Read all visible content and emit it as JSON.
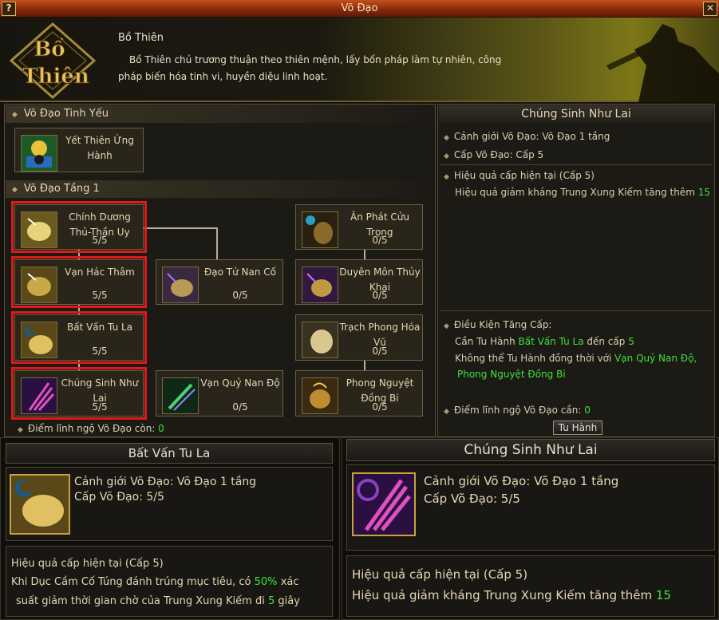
{
  "window": {
    "title": "Võ Đạo",
    "help_glyph": "?",
    "close_glyph": "✕"
  },
  "header": {
    "logo_text": "Bồ Thiên",
    "title": "Bồ Thiên",
    "description": "Bồ Thiên chủ trương thuận theo thiên mệnh, lấy bốn pháp làm tự nhiên, công pháp biến hóa tinh vi, huyền diệu linh hoạt."
  },
  "left_panel": {
    "essence_section": "Võ Đạo Tinh Yếu",
    "essence_skill": {
      "name": "Yết Thiên Ứng Hành",
      "icon": "sun-figure-icon"
    },
    "level_section": "Võ Đạo Tầng 1",
    "skills": [
      {
        "name": "Chính Dương Thủ-Thần Uy",
        "level": "5/5",
        "icon": "fist-icon",
        "selected": true
      },
      {
        "name": "Vạn Hác Thâm",
        "level": "5/5",
        "icon": "fist-icon",
        "selected": true
      },
      {
        "name": "Đạo Tử Nan Cố",
        "level": "0/5",
        "icon": "fist-icon",
        "selected": false
      },
      {
        "name": "Bất Vấn Tu La",
        "level": "5/5",
        "icon": "moon-fist-icon",
        "selected": true
      },
      {
        "name": "Chúng Sinh Như Lai",
        "level": "5/5",
        "icon": "purple-slash-icon",
        "selected": true
      },
      {
        "name": "Vạn Quỷ Nan Độ",
        "level": "0/5",
        "icon": "green-slash-icon",
        "selected": false
      },
      {
        "name": "Ân Phát Cửu Trọng",
        "level": "0/5",
        "icon": "mask-icon",
        "selected": false
      },
      {
        "name": "Duyên Môn Thủy Khai",
        "level": "0/5",
        "icon": "purple-fist-icon",
        "selected": false
      },
      {
        "name": "Trạch Phong Hóa Vũ",
        "level": "0/5",
        "icon": "wind-fist-icon",
        "selected": false
      },
      {
        "name": "Phong Nguyệt Đồng Bi",
        "level": "0/5",
        "icon": "flame-fist-icon",
        "selected": false
      }
    ],
    "points_label": "Điểm lĩnh ngộ Võ Đạo còn:",
    "points_value": "0"
  },
  "right_panel": {
    "title": "Chúng Sinh Như Lai",
    "realm_line": "Cảnh giới Võ Đạo: Võ Đạo 1 tầng",
    "rank_line": "Cấp Võ Đạo: Cấp 5",
    "effect_title": "Hiệu quả cấp hiện tại (Cấp 5)",
    "effect_text": "Hiệu quả giảm kháng Trung Xung Kiếm tăng thêm",
    "effect_value": "15",
    "cond_title": "Điều Kiện Tăng Cấp:",
    "cond_line1_a": "Cần Tu Hành",
    "cond_line1_skill": "Bất Vấn Tu La",
    "cond_line1_b": "đến cấp",
    "cond_line1_level": "5",
    "cond_line2_a": "Không thể Tu Hành đồng thời với",
    "cond_line2_skill1": "Vạn Quỷ Nan Độ,",
    "cond_line2_skill2": "Phong Nguyệt Đồng Bi",
    "points_label": "Điểm lĩnh ngộ Võ Đạo cần:",
    "points_value": "0",
    "train_button": "Tu Hành"
  },
  "tooltip_left": {
    "title": "Bất Vấn Tu La",
    "realm_line": "Cảnh giới Võ Đạo: Võ Đạo 1 tầng",
    "rank_line": "Cấp Võ Đạo: 5/5",
    "effect_title": "Hiệu quả cấp hiện tại (Cấp 5)",
    "effect_a": "Khi Dục Cầm Cố Túng đánh trúng mục tiêu, có",
    "effect_pct": "50%",
    "effect_b": "xác",
    "effect_c": "suất giảm thời gian chờ của Trung Xung Kiếm đi",
    "effect_sec": "5",
    "effect_d": "giây"
  },
  "tooltip_right": {
    "title": "Chúng Sinh Như Lai",
    "realm_line": "Cảnh giới Võ Đạo: Võ Đạo 1 tầng",
    "rank_line": "Cấp Võ Đạo: 5/5",
    "effect_title": "Hiệu quả cấp hiện tại (Cấp 5)",
    "effect_text": "Hiệu quả giảm kháng Trung Xung Kiếm tăng thêm",
    "effect_value": "15"
  },
  "colors": {
    "highlight": "#3ee03e",
    "selected_border": "#e01919",
    "titlebar": "#a33c12"
  }
}
